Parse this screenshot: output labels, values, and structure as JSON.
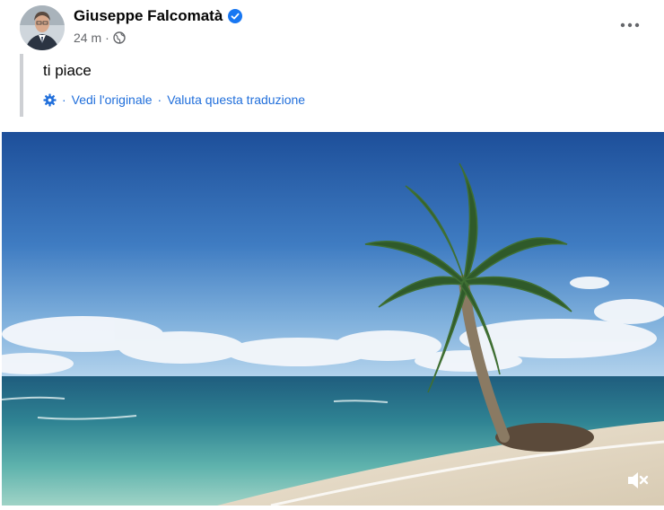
{
  "post": {
    "author": "Giuseppe Falcomatà",
    "time": "24 m",
    "separator": "·",
    "text": "ti piace",
    "translation": {
      "see_original": "Vedi l'originale",
      "rate": "Valuta questa traduzione",
      "separator": "·"
    }
  },
  "icons": {
    "verified": "verified-badge-icon",
    "audience": "globe-icon",
    "more": "more-dots-icon",
    "translation": "gear-icon",
    "mute": "speaker-muted-icon"
  },
  "colors": {
    "link": "#216fdb",
    "meta": "#65676b",
    "verified": "#1877f2"
  }
}
